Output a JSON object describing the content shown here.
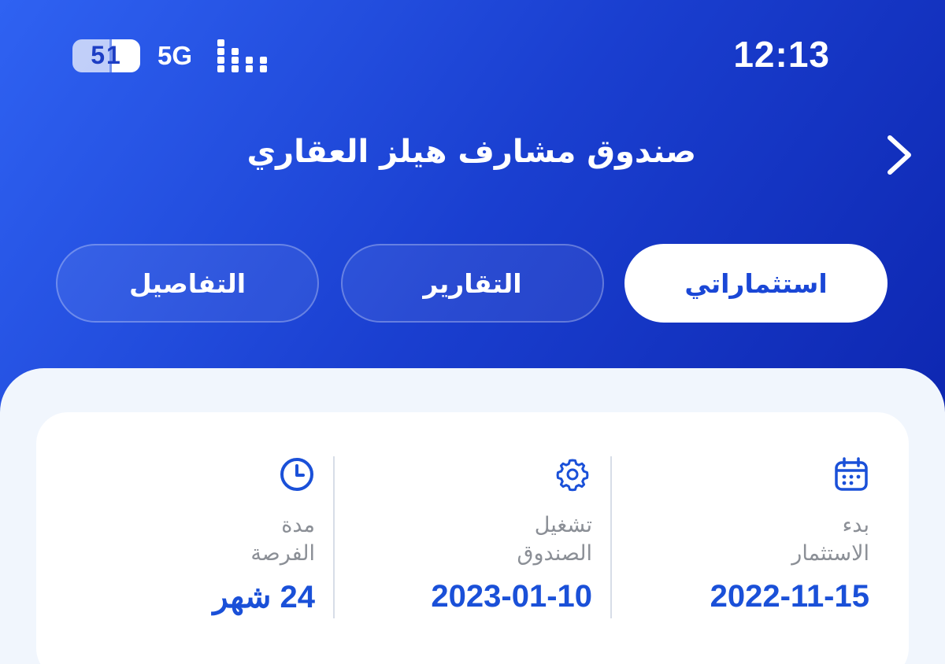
{
  "status_bar": {
    "time": "12:13",
    "battery_level": "51",
    "network": "5G",
    "icons": [
      "battery-icon",
      "signal-icon"
    ]
  },
  "header": {
    "title": "صندوق مشارف هيلز العقاري",
    "back_icon": "chevron-right-icon"
  },
  "tabs": [
    {
      "label": "استثماراتي",
      "active": true
    },
    {
      "label": "التقارير",
      "active": false
    },
    {
      "label": "التفاصيل",
      "active": false
    }
  ],
  "info_card": {
    "items": [
      {
        "icon": "calendar-icon",
        "label_line1": "بدء",
        "label_line2": "الاستثمار",
        "value": "2022-11-15"
      },
      {
        "icon": "gear-icon",
        "label_line1": "تشغيل",
        "label_line2": "الصندوق",
        "value": "2023-01-10"
      },
      {
        "icon": "clock-icon",
        "label_line1": "مدة",
        "label_line2": "الفرصة",
        "value": "24 شهر"
      }
    ]
  },
  "colors": {
    "accent": "#1a50d8",
    "header_gradient_start": "#2f62f2",
    "header_gradient_end": "#0a20a8",
    "sheet_background": "#f1f6fd",
    "label_gray": "#8b8f96"
  }
}
